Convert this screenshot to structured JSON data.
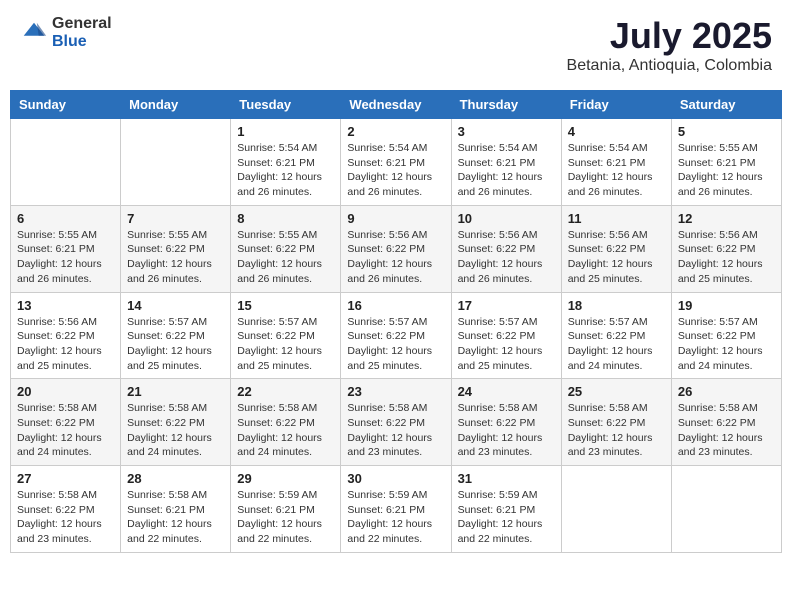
{
  "header": {
    "logo_general": "General",
    "logo_blue": "Blue",
    "month_year": "July 2025",
    "location": "Betania, Antioquia, Colombia"
  },
  "days_of_week": [
    "Sunday",
    "Monday",
    "Tuesday",
    "Wednesday",
    "Thursday",
    "Friday",
    "Saturday"
  ],
  "weeks": [
    [
      {
        "day": "",
        "info": ""
      },
      {
        "day": "",
        "info": ""
      },
      {
        "day": "1",
        "info": "Sunrise: 5:54 AM\nSunset: 6:21 PM\nDaylight: 12 hours and 26 minutes."
      },
      {
        "day": "2",
        "info": "Sunrise: 5:54 AM\nSunset: 6:21 PM\nDaylight: 12 hours and 26 minutes."
      },
      {
        "day": "3",
        "info": "Sunrise: 5:54 AM\nSunset: 6:21 PM\nDaylight: 12 hours and 26 minutes."
      },
      {
        "day": "4",
        "info": "Sunrise: 5:54 AM\nSunset: 6:21 PM\nDaylight: 12 hours and 26 minutes."
      },
      {
        "day": "5",
        "info": "Sunrise: 5:55 AM\nSunset: 6:21 PM\nDaylight: 12 hours and 26 minutes."
      }
    ],
    [
      {
        "day": "6",
        "info": "Sunrise: 5:55 AM\nSunset: 6:21 PM\nDaylight: 12 hours and 26 minutes."
      },
      {
        "day": "7",
        "info": "Sunrise: 5:55 AM\nSunset: 6:22 PM\nDaylight: 12 hours and 26 minutes."
      },
      {
        "day": "8",
        "info": "Sunrise: 5:55 AM\nSunset: 6:22 PM\nDaylight: 12 hours and 26 minutes."
      },
      {
        "day": "9",
        "info": "Sunrise: 5:56 AM\nSunset: 6:22 PM\nDaylight: 12 hours and 26 minutes."
      },
      {
        "day": "10",
        "info": "Sunrise: 5:56 AM\nSunset: 6:22 PM\nDaylight: 12 hours and 26 minutes."
      },
      {
        "day": "11",
        "info": "Sunrise: 5:56 AM\nSunset: 6:22 PM\nDaylight: 12 hours and 25 minutes."
      },
      {
        "day": "12",
        "info": "Sunrise: 5:56 AM\nSunset: 6:22 PM\nDaylight: 12 hours and 25 minutes."
      }
    ],
    [
      {
        "day": "13",
        "info": "Sunrise: 5:56 AM\nSunset: 6:22 PM\nDaylight: 12 hours and 25 minutes."
      },
      {
        "day": "14",
        "info": "Sunrise: 5:57 AM\nSunset: 6:22 PM\nDaylight: 12 hours and 25 minutes."
      },
      {
        "day": "15",
        "info": "Sunrise: 5:57 AM\nSunset: 6:22 PM\nDaylight: 12 hours and 25 minutes."
      },
      {
        "day": "16",
        "info": "Sunrise: 5:57 AM\nSunset: 6:22 PM\nDaylight: 12 hours and 25 minutes."
      },
      {
        "day": "17",
        "info": "Sunrise: 5:57 AM\nSunset: 6:22 PM\nDaylight: 12 hours and 25 minutes."
      },
      {
        "day": "18",
        "info": "Sunrise: 5:57 AM\nSunset: 6:22 PM\nDaylight: 12 hours and 24 minutes."
      },
      {
        "day": "19",
        "info": "Sunrise: 5:57 AM\nSunset: 6:22 PM\nDaylight: 12 hours and 24 minutes."
      }
    ],
    [
      {
        "day": "20",
        "info": "Sunrise: 5:58 AM\nSunset: 6:22 PM\nDaylight: 12 hours and 24 minutes."
      },
      {
        "day": "21",
        "info": "Sunrise: 5:58 AM\nSunset: 6:22 PM\nDaylight: 12 hours and 24 minutes."
      },
      {
        "day": "22",
        "info": "Sunrise: 5:58 AM\nSunset: 6:22 PM\nDaylight: 12 hours and 24 minutes."
      },
      {
        "day": "23",
        "info": "Sunrise: 5:58 AM\nSunset: 6:22 PM\nDaylight: 12 hours and 23 minutes."
      },
      {
        "day": "24",
        "info": "Sunrise: 5:58 AM\nSunset: 6:22 PM\nDaylight: 12 hours and 23 minutes."
      },
      {
        "day": "25",
        "info": "Sunrise: 5:58 AM\nSunset: 6:22 PM\nDaylight: 12 hours and 23 minutes."
      },
      {
        "day": "26",
        "info": "Sunrise: 5:58 AM\nSunset: 6:22 PM\nDaylight: 12 hours and 23 minutes."
      }
    ],
    [
      {
        "day": "27",
        "info": "Sunrise: 5:58 AM\nSunset: 6:22 PM\nDaylight: 12 hours and 23 minutes."
      },
      {
        "day": "28",
        "info": "Sunrise: 5:58 AM\nSunset: 6:21 PM\nDaylight: 12 hours and 22 minutes."
      },
      {
        "day": "29",
        "info": "Sunrise: 5:59 AM\nSunset: 6:21 PM\nDaylight: 12 hours and 22 minutes."
      },
      {
        "day": "30",
        "info": "Sunrise: 5:59 AM\nSunset: 6:21 PM\nDaylight: 12 hours and 22 minutes."
      },
      {
        "day": "31",
        "info": "Sunrise: 5:59 AM\nSunset: 6:21 PM\nDaylight: 12 hours and 22 minutes."
      },
      {
        "day": "",
        "info": ""
      },
      {
        "day": "",
        "info": ""
      }
    ]
  ]
}
